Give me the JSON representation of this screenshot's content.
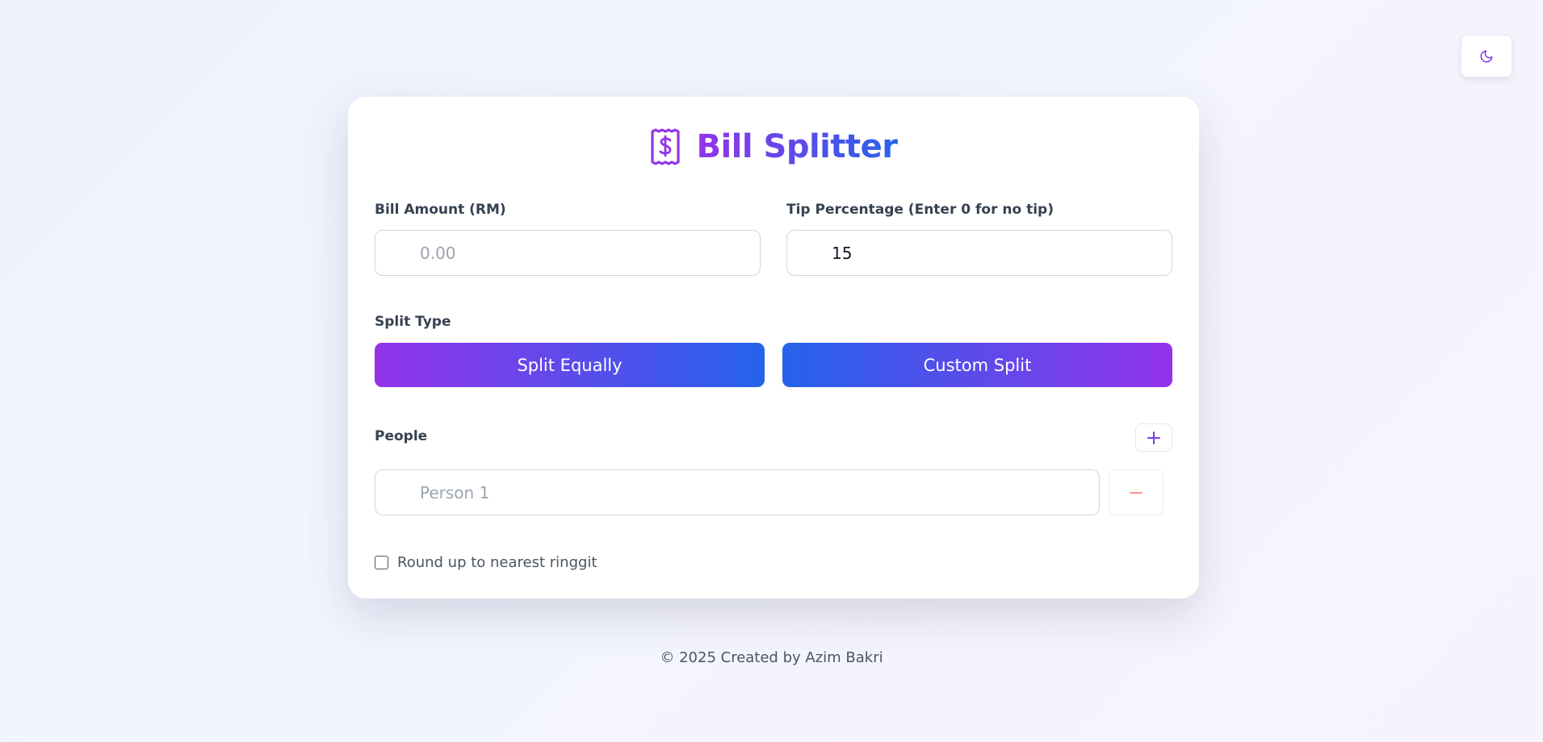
{
  "app": {
    "title": "Bill Splitter",
    "accent_colors": {
      "purple": "#9333ea",
      "blue": "#2563eb"
    }
  },
  "theme_toggle": {
    "icon": "moon-icon"
  },
  "header": {
    "icon": "receipt-icon"
  },
  "bill_amount": {
    "label": "Bill Amount (RM)",
    "placeholder": "0.00",
    "value": ""
  },
  "tip": {
    "label": "Tip Percentage (Enter 0 for no tip)",
    "value": "15"
  },
  "split_type": {
    "label": "Split Type",
    "options": [
      "Split Equally",
      "Custom Split"
    ]
  },
  "people": {
    "label": "People",
    "add_icon": "plus-icon",
    "remove_icon": "minus-icon",
    "list": [
      {
        "placeholder": "Person 1",
        "value": ""
      }
    ]
  },
  "round_up": {
    "label": "Round up to nearest ringgit",
    "checked": false
  },
  "footer": {
    "text": "© 2025 Created by Azim Bakri"
  }
}
